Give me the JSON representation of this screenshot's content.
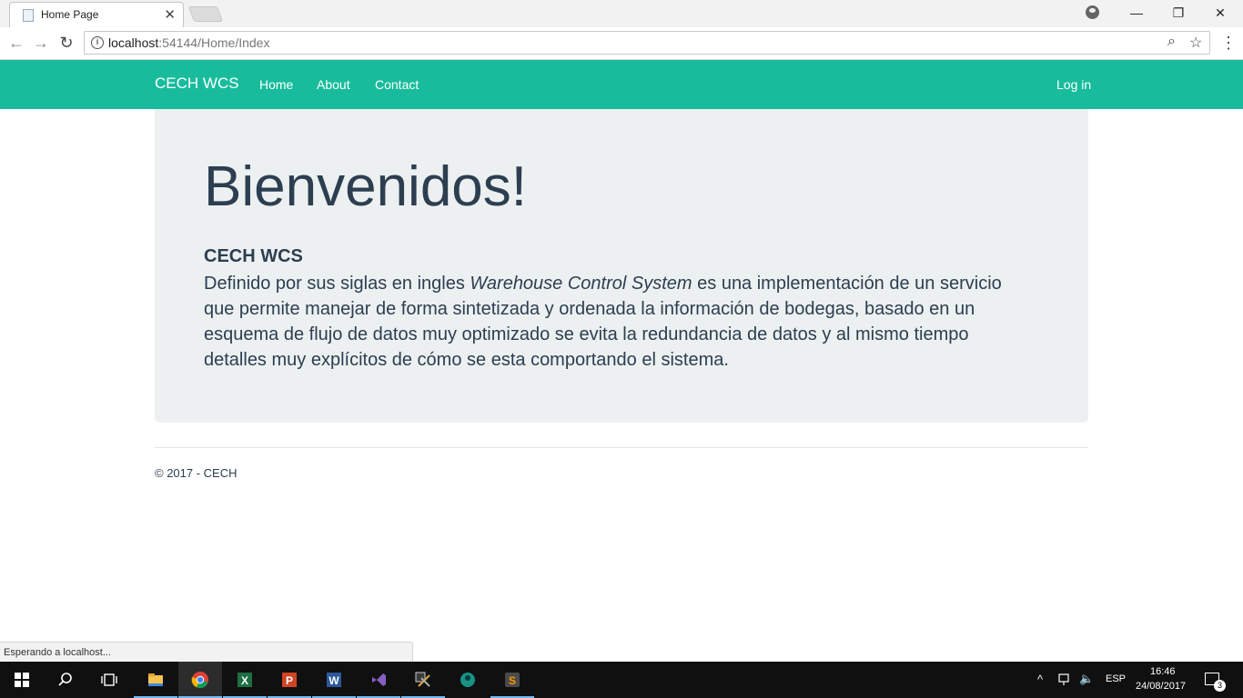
{
  "browser": {
    "tab_title": "Home Page",
    "tab_close": "✕",
    "url_host": "localhost",
    "url_path": ":54144/Home/Index",
    "window_controls": {
      "minimize": "—",
      "restore": "❐",
      "close": "✕"
    },
    "status_text": "Esperando a localhost..."
  },
  "navbar": {
    "brand": "CECH WCS",
    "links": [
      "Home",
      "About",
      "Contact"
    ],
    "login": "Log in",
    "color": "#18bc9c"
  },
  "jumbotron": {
    "title": "Bienvenidos!",
    "heading": "CECH WCS",
    "text_before": "Definido por sus siglas en ingles ",
    "text_em": "Warehouse Control System",
    "text_after": " es una implementación de un servicio que permite manejar de forma sintetizada y ordenada la información de bodegas, basado en un esquema de flujo de datos muy optimizado se evita la redundancia de datos y al mismo tiempo detalles muy explícitos de cómo se esta comportando el sistema."
  },
  "footer": {
    "text": "© 2017 - CECH"
  },
  "taskbar": {
    "apps": [
      "start-icon",
      "search-icon",
      "task-view-icon",
      "file-explorer-icon",
      "chrome-icon",
      "excel-icon",
      "powerpoint-icon",
      "word-icon",
      "visual-studio-icon",
      "tools-icon",
      "gitkraken-icon",
      "sublime-icon"
    ],
    "language": "ESP",
    "time": "16:46",
    "date": "24/08/2017",
    "notifications": "3"
  }
}
